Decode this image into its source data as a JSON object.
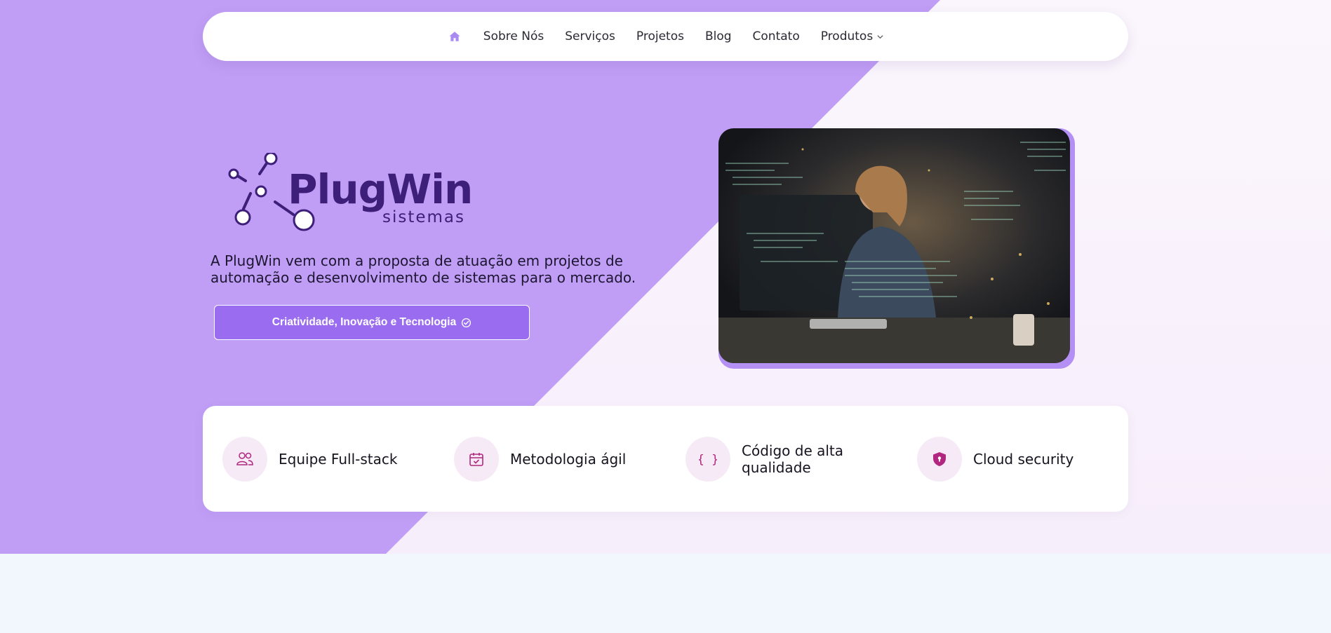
{
  "colors": {
    "purple_bg": "#c09ef6",
    "accent": "#9a6cf0",
    "logo_dark": "#3d1f7a",
    "icon_magenta": "#b1277f"
  },
  "nav": {
    "home_icon": "home-icon",
    "items": [
      {
        "label": "Sobre Nós"
      },
      {
        "label": "Serviços"
      },
      {
        "label": "Projetos"
      },
      {
        "label": "Blog"
      },
      {
        "label": "Contato"
      },
      {
        "label": "Produtos",
        "icon": "chevron-down-icon"
      }
    ]
  },
  "hero": {
    "logo_main": "PlugWin",
    "logo_sub": "sistemas",
    "tagline": "A PlugWin vem com a proposta de atuação em projetos de automação e desenvolvimento de sistemas para o mercado.",
    "cta_label": "Criatividade, Inovação e Tecnologia",
    "cta_icon": "check-circle-icon",
    "photo": "developer-woman-with-code-overlay"
  },
  "features": [
    {
      "title": "Equipe Full-stack",
      "icon": "users-icon"
    },
    {
      "title": "Metodologia ágil",
      "icon": "calendar-check-icon"
    },
    {
      "title": "Código de alta qualidade",
      "icon": "code-braces-icon"
    },
    {
      "title": "Cloud security",
      "icon": "shield-icon"
    }
  ]
}
